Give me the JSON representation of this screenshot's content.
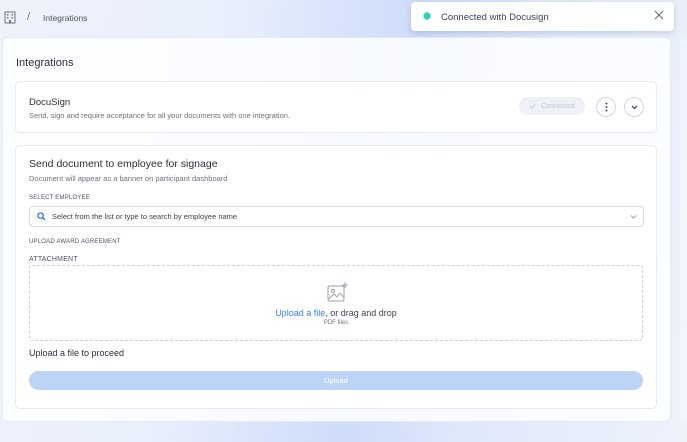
{
  "breadcrumb": {
    "separator": "/",
    "current": "Integrations"
  },
  "toast": {
    "message": "Connected with Docusign",
    "dot_color": "#2dd4bf"
  },
  "page": {
    "title": "Integrations"
  },
  "docusign_card": {
    "name": "DocuSign",
    "description": "Send, sign and require acceptance for all your documents with one integration.",
    "status_label": "Connected"
  },
  "send_card": {
    "title": "Send document to employee for signage",
    "subtitle": "Document will appear as a banner on participant dashboard",
    "select_employee_label": "SELECT EMPLOYEE",
    "select_employee_placeholder": "Select from the list or type to search by employee name",
    "upload_award_label": "UPLOAD AWARD AGREEMENT",
    "attachment_label": "ATTACHMENT",
    "upload_link": "Upload a file",
    "upload_rest": ", or drag and drop",
    "file_hint": "PDF files",
    "proceed_text": "Upload a file to proceed",
    "upload_button": "Upload"
  },
  "colors": {
    "accent": "#3b82f6",
    "upload_button_bg": "#bcd4f8"
  }
}
